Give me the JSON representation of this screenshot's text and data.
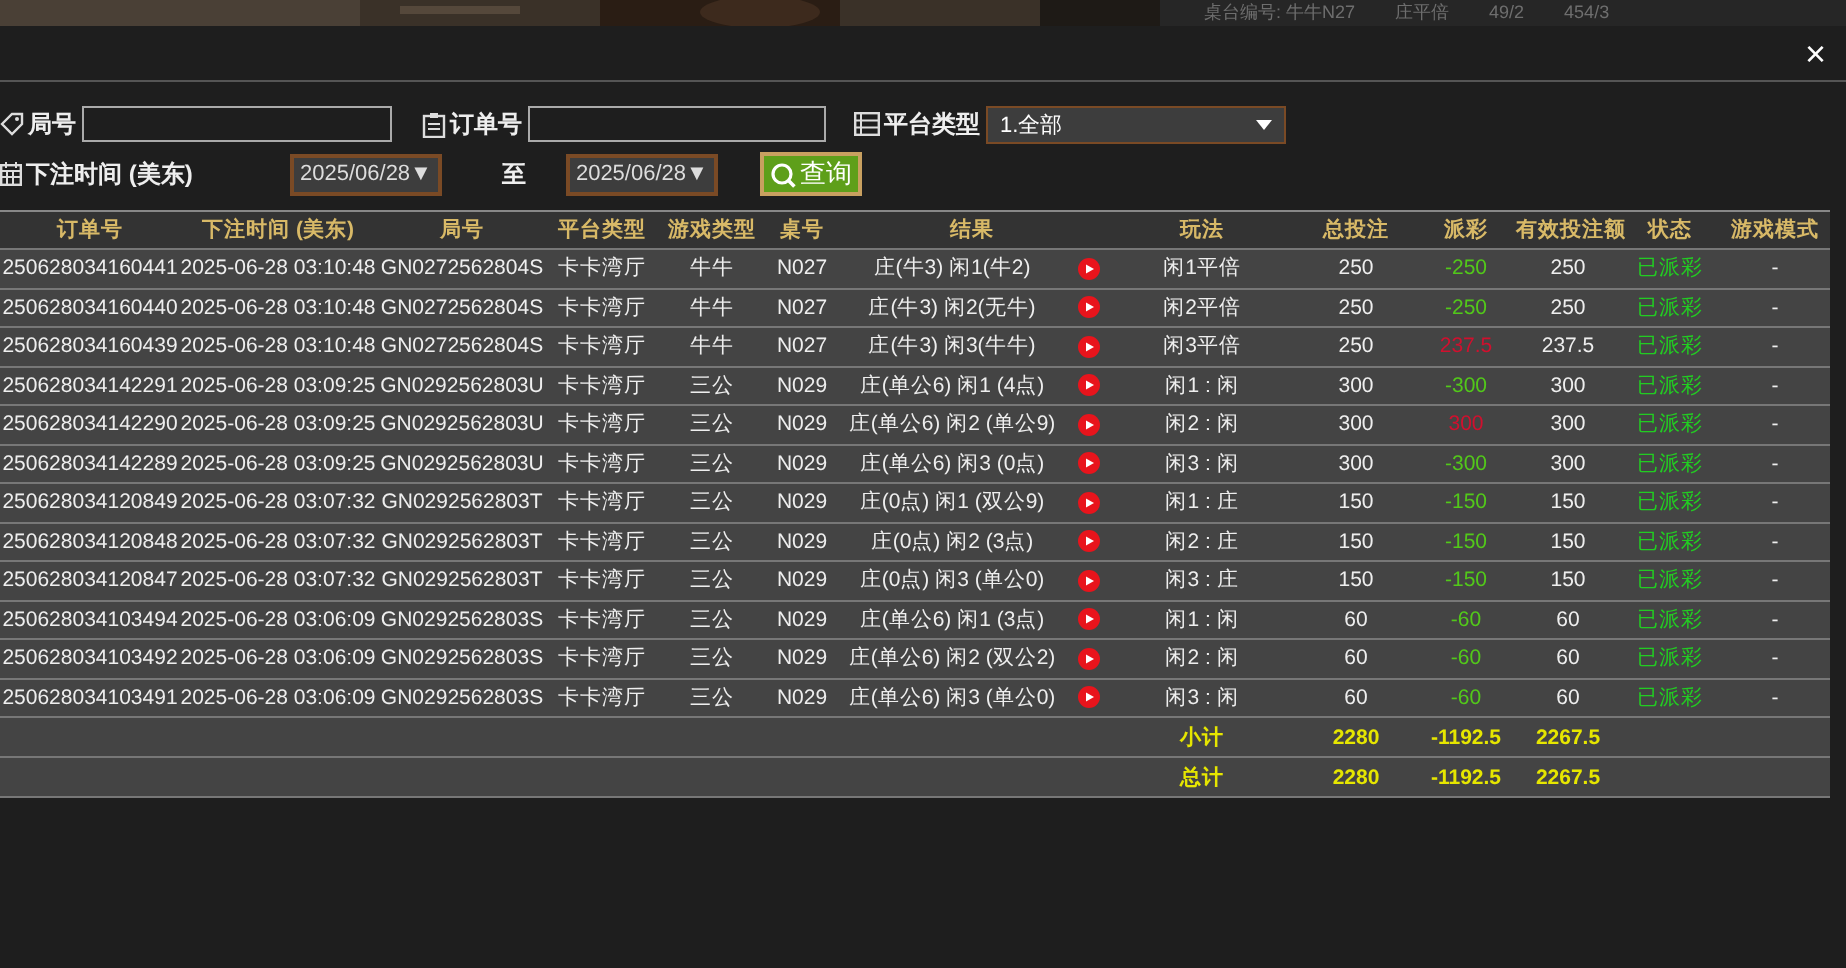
{
  "backdrop": {
    "texts": [
      "桌台编号: 牛牛N27",
      "庄平倍",
      "49/2",
      "454/3"
    ]
  },
  "dialog": {
    "close": "×"
  },
  "filters": {
    "round_label": "局号",
    "order_label": "订单号",
    "platform_label": "平台类型",
    "platform_value": "1.全部",
    "time_label": "下注时间 (美东)",
    "date_from": "2025/06/28▼",
    "to_label": "至",
    "date_to": "2025/06/28▼",
    "query_button": "查询"
  },
  "table": {
    "columns": [
      "订单号",
      "下注时间 (美东)",
      "局号",
      "平台类型",
      "游戏类型",
      "桌号",
      "结果",
      "玩法",
      "总投注",
      "派彩",
      "有效投注额",
      "状态",
      "游戏模式"
    ],
    "rows": [
      {
        "order": "250628034160441",
        "time": "2025-06-28 03:10:48",
        "round": "GN0272562804S",
        "platform": "卡卡湾厅",
        "game": "牛牛",
        "table": "N027",
        "result": "庄(牛3) 闲1(牛2)",
        "play": "闲1平倍",
        "bet": "250",
        "payout": "-250",
        "color": "#52c81a",
        "valid": "250",
        "status": "已派彩",
        "mode": "-"
      },
      {
        "order": "250628034160440",
        "time": "2025-06-28 03:10:48",
        "round": "GN0272562804S",
        "platform": "卡卡湾厅",
        "game": "牛牛",
        "table": "N027",
        "result": "庄(牛3) 闲2(无牛)",
        "play": "闲2平倍",
        "bet": "250",
        "payout": "-250",
        "color": "#52c81a",
        "valid": "250",
        "status": "已派彩",
        "mode": "-"
      },
      {
        "order": "250628034160439",
        "time": "2025-06-28 03:10:48",
        "round": "GN0272562804S",
        "platform": "卡卡湾厅",
        "game": "牛牛",
        "table": "N027",
        "result": "庄(牛3) 闲3(牛牛)",
        "play": "闲3平倍",
        "bet": "250",
        "payout": "237.5",
        "color": "#d0102e",
        "valid": "237.5",
        "status": "已派彩",
        "mode": "-"
      },
      {
        "order": "250628034142291",
        "time": "2025-06-28 03:09:25",
        "round": "GN0292562803U",
        "platform": "卡卡湾厅",
        "game": "三公",
        "table": "N029",
        "result": "庄(单公6) 闲1 (4点)",
        "play": "闲1 : 闲",
        "bet": "300",
        "payout": "-300",
        "color": "#52c81a",
        "valid": "300",
        "status": "已派彩",
        "mode": "-"
      },
      {
        "order": "250628034142290",
        "time": "2025-06-28 03:09:25",
        "round": "GN0292562803U",
        "platform": "卡卡湾厅",
        "game": "三公",
        "table": "N029",
        "result": "庄(单公6) 闲2 (单公9)",
        "play": "闲2 : 闲",
        "bet": "300",
        "payout": "300",
        "color": "#d0102e",
        "valid": "300",
        "status": "已派彩",
        "mode": "-"
      },
      {
        "order": "250628034142289",
        "time": "2025-06-28 03:09:25",
        "round": "GN0292562803U",
        "platform": "卡卡湾厅",
        "game": "三公",
        "table": "N029",
        "result": "庄(单公6) 闲3 (0点)",
        "play": "闲3 : 闲",
        "bet": "300",
        "payout": "-300",
        "color": "#52c81a",
        "valid": "300",
        "status": "已派彩",
        "mode": "-"
      },
      {
        "order": "250628034120849",
        "time": "2025-06-28 03:07:32",
        "round": "GN0292562803T",
        "platform": "卡卡湾厅",
        "game": "三公",
        "table": "N029",
        "result": "庄(0点) 闲1 (双公9)",
        "play": "闲1 : 庄",
        "bet": "150",
        "payout": "-150",
        "color": "#52c81a",
        "valid": "150",
        "status": "已派彩",
        "mode": "-"
      },
      {
        "order": "250628034120848",
        "time": "2025-06-28 03:07:32",
        "round": "GN0292562803T",
        "platform": "卡卡湾厅",
        "game": "三公",
        "table": "N029",
        "result": "庄(0点) 闲2 (3点)",
        "play": "闲2 : 庄",
        "bet": "150",
        "payout": "-150",
        "color": "#52c81a",
        "valid": "150",
        "status": "已派彩",
        "mode": "-"
      },
      {
        "order": "250628034120847",
        "time": "2025-06-28 03:07:32",
        "round": "GN0292562803T",
        "platform": "卡卡湾厅",
        "game": "三公",
        "table": "N029",
        "result": "庄(0点) 闲3 (单公0)",
        "play": "闲3 : 庄",
        "bet": "150",
        "payout": "-150",
        "color": "#52c81a",
        "valid": "150",
        "status": "已派彩",
        "mode": "-"
      },
      {
        "order": "250628034103494",
        "time": "2025-06-28 03:06:09",
        "round": "GN0292562803S",
        "platform": "卡卡湾厅",
        "game": "三公",
        "table": "N029",
        "result": "庄(单公6) 闲1 (3点)",
        "play": "闲1 : 闲",
        "bet": "60",
        "payout": "-60",
        "color": "#52c81a",
        "valid": "60",
        "status": "已派彩",
        "mode": "-"
      },
      {
        "order": "250628034103492",
        "time": "2025-06-28 03:06:09",
        "round": "GN0292562803S",
        "platform": "卡卡湾厅",
        "game": "三公",
        "table": "N029",
        "result": "庄(单公6) 闲2 (双公2)",
        "play": "闲2 : 闲",
        "bet": "60",
        "payout": "-60",
        "color": "#52c81a",
        "valid": "60",
        "status": "已派彩",
        "mode": "-"
      },
      {
        "order": "250628034103491",
        "time": "2025-06-28 03:06:09",
        "round": "GN0292562803S",
        "platform": "卡卡湾厅",
        "game": "三公",
        "table": "N029",
        "result": "庄(单公6) 闲3 (单公0)",
        "play": "闲3 : 闲",
        "bet": "60",
        "payout": "-60",
        "color": "#52c81a",
        "valid": "60",
        "status": "已派彩",
        "mode": "-"
      }
    ],
    "totals": [
      {
        "label": "小计",
        "bet": "2280",
        "payout": "-1192.5",
        "valid": "2267.5"
      },
      {
        "label": "总计",
        "bet": "2280",
        "payout": "-1192.5",
        "valid": "2267.5"
      }
    ]
  }
}
